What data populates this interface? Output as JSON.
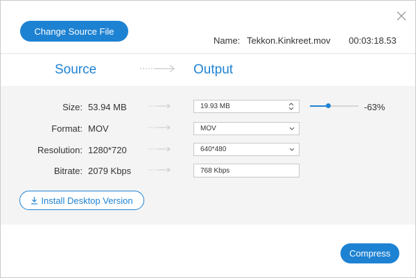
{
  "header": {
    "change_source_label": "Change Source File",
    "name_label": "Name:",
    "file_name": "Tekkon.Kinkreet.mov",
    "duration": "00:03:18.53"
  },
  "columns": {
    "source": "Source",
    "output": "Output"
  },
  "rows": {
    "size": {
      "label": "Size:",
      "source": "53.94 MB",
      "output": "19.93  MB"
    },
    "format": {
      "label": "Format:",
      "source": "MOV",
      "output": "MOV"
    },
    "resolution": {
      "label": "Resolution:",
      "source": "1280*720",
      "output": "640*480"
    },
    "bitrate": {
      "label": "Bitrate:",
      "source": "2079 Kbps",
      "output": "768 Kbps"
    }
  },
  "slider": {
    "level_fraction": 0.37,
    "percent_label": "-63%"
  },
  "install_label": "Install Desktop Version",
  "compress_label": "Compress",
  "colors": {
    "accent": "#1e82d2",
    "panel_bg": "#f4f4f4",
    "arrow": "#c8c8c8"
  },
  "icons": {
    "close": "close-icon",
    "download": "download-icon",
    "arrow": "arrow-right-icon",
    "stepper": "stepper-icon",
    "caret": "chevron-down-icon"
  }
}
